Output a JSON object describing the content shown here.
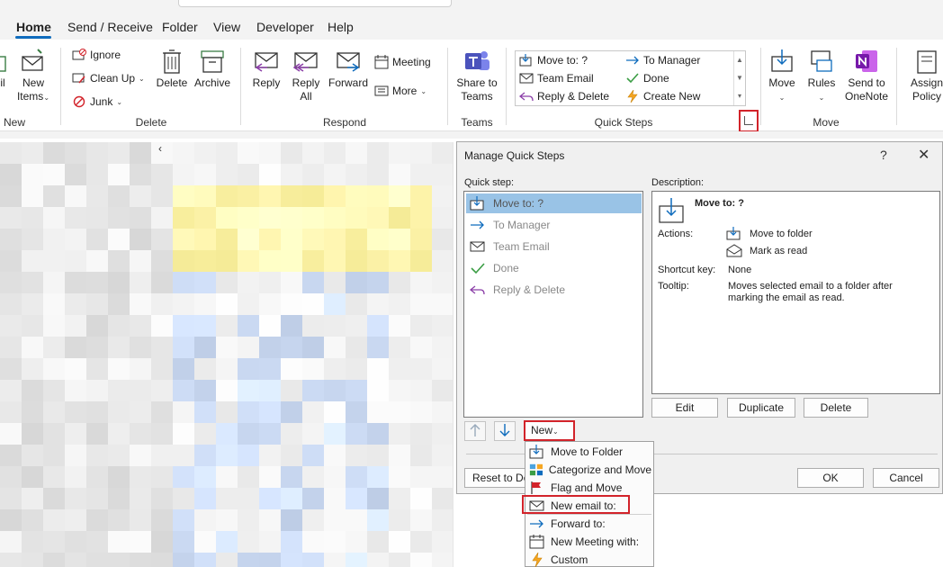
{
  "tabs": [
    "Home",
    "Send / Receive",
    "Folder",
    "View",
    "Developer",
    "Help"
  ],
  "ribbon": {
    "new": {
      "label_new": "New",
      "label_items": "Items",
      "partial_label": "il",
      "group": "New"
    },
    "delete_group": {
      "ignore": "Ignore",
      "cleanup": "Clean Up",
      "junk": "Junk",
      "delete": "Delete",
      "archive": "Archive",
      "group": "Delete"
    },
    "respond": {
      "reply": "Reply",
      "reply_all_1": "Reply",
      "reply_all_2": "All",
      "forward": "Forward",
      "meeting": "Meeting",
      "more": "More",
      "group": "Respond"
    },
    "teams": {
      "line1": "Share to",
      "line2": "Teams",
      "group": "Teams"
    },
    "quick_steps": {
      "items": [
        "Move to: ?",
        "To Manager",
        "Team Email",
        "Done",
        "Reply & Delete",
        "Create New"
      ],
      "group": "Quick Steps"
    },
    "move": {
      "move": "Move",
      "rules": "Rules",
      "onenote_1": "Send to",
      "onenote_2": "OneNote",
      "group": "Move"
    },
    "assign": {
      "line1": "Assign",
      "line2": "Policy"
    }
  },
  "dialog": {
    "title": "Manage Quick Steps",
    "help": "?",
    "close": "✕",
    "quick_step_label": "Quick step:",
    "description_label": "Description:",
    "quick_steps": [
      "Move to: ?",
      "To Manager",
      "Team Email",
      "Done",
      "Reply & Delete"
    ],
    "description": {
      "title": "Move to: ?",
      "actions_label": "Actions:",
      "actions": [
        "Move to folder",
        "Mark as read"
      ],
      "shortcut_label": "Shortcut key:",
      "shortcut_value": "None",
      "tooltip_label": "Tooltip:",
      "tooltip_line1": "Moves selected email to a folder after",
      "tooltip_line2": "marking the email as read."
    },
    "buttons": {
      "edit": "Edit",
      "duplicate": "Duplicate",
      "delete": "Delete",
      "new": "New",
      "reset": "Reset to De",
      "ok": "OK",
      "cancel": "Cancel"
    }
  },
  "menu": {
    "items": [
      "Move to Folder",
      "Categorize and Move",
      "Flag and Move",
      "New email to:",
      "Forward to:",
      "New Meeting with:",
      "Custom"
    ]
  },
  "colors": {
    "accent": "#0f6cbd",
    "highlight": "#d2232a",
    "selection": "#99c3e6"
  }
}
